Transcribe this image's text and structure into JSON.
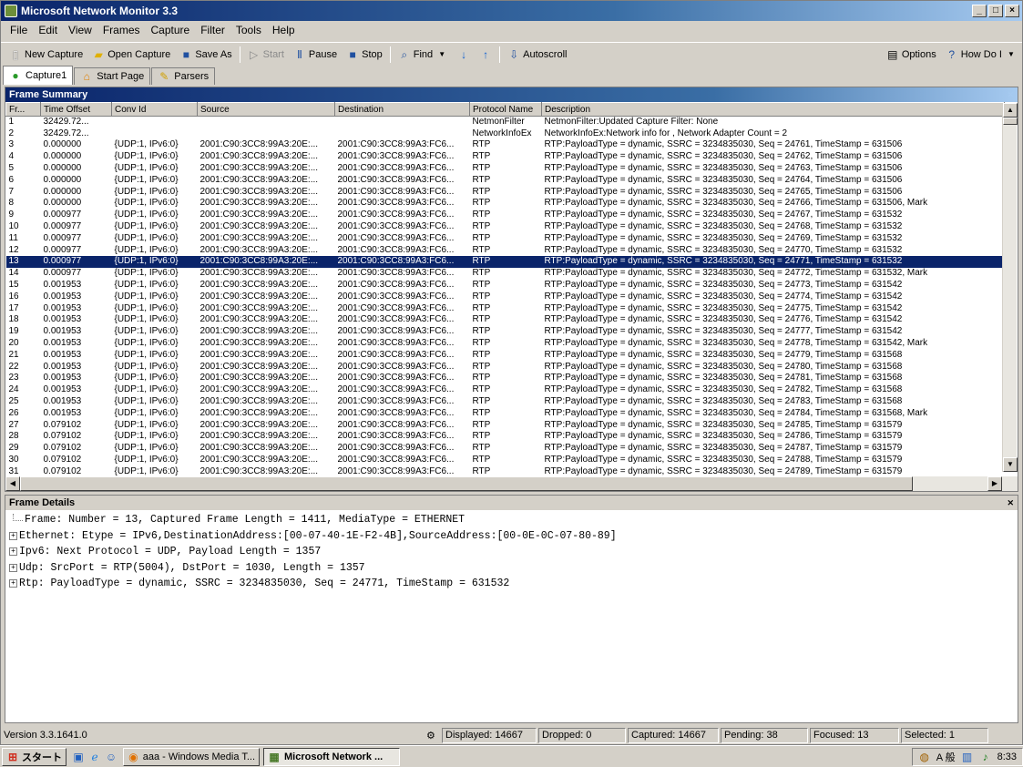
{
  "window": {
    "title": "Microsoft Network Monitor 3.3"
  },
  "menu": [
    "File",
    "Edit",
    "View",
    "Frames",
    "Capture",
    "Filter",
    "Tools",
    "Help"
  ],
  "toolbar": {
    "new_capture": "New Capture",
    "open_capture": "Open Capture",
    "save_as": "Save As",
    "start": "Start",
    "pause": "Pause",
    "stop": "Stop",
    "find": "Find",
    "autoscroll": "Autoscroll",
    "options": "Options",
    "how_do_i": "How Do I"
  },
  "tabs": [
    "Capture1",
    "Start Page",
    "Parsers"
  ],
  "frame_summary": {
    "title": "Frame Summary",
    "columns": [
      "Fr...",
      "Time Offset",
      "Conv Id",
      "Source",
      "Destination",
      "Protocol Name",
      "Description"
    ],
    "selected_row": 12,
    "rows": [
      [
        "1",
        "32429.72...",
        "",
        "",
        "",
        "NetmonFilter",
        "NetmonFilter:Updated Capture Filter: None"
      ],
      [
        "2",
        "32429.72...",
        "",
        "",
        "",
        "NetworkInfoEx",
        "NetworkInfoEx:Network info for , Network Adapter Count = 2"
      ],
      [
        "3",
        "0.000000",
        "{UDP:1, IPv6:0}",
        "2001:C90:3CC8:99A3:20E:...",
        "2001:C90:3CC8:99A3:FC6...",
        "RTP",
        "RTP:PayloadType = dynamic, SSRC = 3234835030, Seq = 24761, TimeStamp = 631506"
      ],
      [
        "4",
        "0.000000",
        "{UDP:1, IPv6:0}",
        "2001:C90:3CC8:99A3:20E:...",
        "2001:C90:3CC8:99A3:FC6...",
        "RTP",
        "RTP:PayloadType = dynamic, SSRC = 3234835030, Seq = 24762, TimeStamp = 631506"
      ],
      [
        "5",
        "0.000000",
        "{UDP:1, IPv6:0}",
        "2001:C90:3CC8:99A3:20E:...",
        "2001:C90:3CC8:99A3:FC6...",
        "RTP",
        "RTP:PayloadType = dynamic, SSRC = 3234835030, Seq = 24763, TimeStamp = 631506"
      ],
      [
        "6",
        "0.000000",
        "{UDP:1, IPv6:0}",
        "2001:C90:3CC8:99A3:20E:...",
        "2001:C90:3CC8:99A3:FC6...",
        "RTP",
        "RTP:PayloadType = dynamic, SSRC = 3234835030, Seq = 24764, TimeStamp = 631506"
      ],
      [
        "7",
        "0.000000",
        "{UDP:1, IPv6:0}",
        "2001:C90:3CC8:99A3:20E:...",
        "2001:C90:3CC8:99A3:FC6...",
        "RTP",
        "RTP:PayloadType = dynamic, SSRC = 3234835030, Seq = 24765, TimeStamp = 631506"
      ],
      [
        "8",
        "0.000000",
        "{UDP:1, IPv6:0}",
        "2001:C90:3CC8:99A3:20E:...",
        "2001:C90:3CC8:99A3:FC6...",
        "RTP",
        "RTP:PayloadType = dynamic, SSRC = 3234835030, Seq = 24766, TimeStamp = 631506, Mark"
      ],
      [
        "9",
        "0.000977",
        "{UDP:1, IPv6:0}",
        "2001:C90:3CC8:99A3:20E:...",
        "2001:C90:3CC8:99A3:FC6...",
        "RTP",
        "RTP:PayloadType = dynamic, SSRC = 3234835030, Seq = 24767, TimeStamp = 631532"
      ],
      [
        "10",
        "0.000977",
        "{UDP:1, IPv6:0}",
        "2001:C90:3CC8:99A3:20E:...",
        "2001:C90:3CC8:99A3:FC6...",
        "RTP",
        "RTP:PayloadType = dynamic, SSRC = 3234835030, Seq = 24768, TimeStamp = 631532"
      ],
      [
        "11",
        "0.000977",
        "{UDP:1, IPv6:0}",
        "2001:C90:3CC8:99A3:20E:...",
        "2001:C90:3CC8:99A3:FC6...",
        "RTP",
        "RTP:PayloadType = dynamic, SSRC = 3234835030, Seq = 24769, TimeStamp = 631532"
      ],
      [
        "12",
        "0.000977",
        "{UDP:1, IPv6:0}",
        "2001:C90:3CC8:99A3:20E:...",
        "2001:C90:3CC8:99A3:FC6...",
        "RTP",
        "RTP:PayloadType = dynamic, SSRC = 3234835030, Seq = 24770, TimeStamp = 631532"
      ],
      [
        "13",
        "0.000977",
        "{UDP:1, IPv6:0}",
        "2001:C90:3CC8:99A3:20E:...",
        "2001:C90:3CC8:99A3:FC6...",
        "RTP",
        "RTP:PayloadType = dynamic, SSRC = 3234835030, Seq = 24771, TimeStamp = 631532"
      ],
      [
        "14",
        "0.000977",
        "{UDP:1, IPv6:0}",
        "2001:C90:3CC8:99A3:20E:...",
        "2001:C90:3CC8:99A3:FC6...",
        "RTP",
        "RTP:PayloadType = dynamic, SSRC = 3234835030, Seq = 24772, TimeStamp = 631532, Mark"
      ],
      [
        "15",
        "0.001953",
        "{UDP:1, IPv6:0}",
        "2001:C90:3CC8:99A3:20E:...",
        "2001:C90:3CC8:99A3:FC6...",
        "RTP",
        "RTP:PayloadType = dynamic, SSRC = 3234835030, Seq = 24773, TimeStamp = 631542"
      ],
      [
        "16",
        "0.001953",
        "{UDP:1, IPv6:0}",
        "2001:C90:3CC8:99A3:20E:...",
        "2001:C90:3CC8:99A3:FC6...",
        "RTP",
        "RTP:PayloadType = dynamic, SSRC = 3234835030, Seq = 24774, TimeStamp = 631542"
      ],
      [
        "17",
        "0.001953",
        "{UDP:1, IPv6:0}",
        "2001:C90:3CC8:99A3:20E:...",
        "2001:C90:3CC8:99A3:FC6...",
        "RTP",
        "RTP:PayloadType = dynamic, SSRC = 3234835030, Seq = 24775, TimeStamp = 631542"
      ],
      [
        "18",
        "0.001953",
        "{UDP:1, IPv6:0}",
        "2001:C90:3CC8:99A3:20E:...",
        "2001:C90:3CC8:99A3:FC6...",
        "RTP",
        "RTP:PayloadType = dynamic, SSRC = 3234835030, Seq = 24776, TimeStamp = 631542"
      ],
      [
        "19",
        "0.001953",
        "{UDP:1, IPv6:0}",
        "2001:C90:3CC8:99A3:20E:...",
        "2001:C90:3CC8:99A3:FC6...",
        "RTP",
        "RTP:PayloadType = dynamic, SSRC = 3234835030, Seq = 24777, TimeStamp = 631542"
      ],
      [
        "20",
        "0.001953",
        "{UDP:1, IPv6:0}",
        "2001:C90:3CC8:99A3:20E:...",
        "2001:C90:3CC8:99A3:FC6...",
        "RTP",
        "RTP:PayloadType = dynamic, SSRC = 3234835030, Seq = 24778, TimeStamp = 631542, Mark"
      ],
      [
        "21",
        "0.001953",
        "{UDP:1, IPv6:0}",
        "2001:C90:3CC8:99A3:20E:...",
        "2001:C90:3CC8:99A3:FC6...",
        "RTP",
        "RTP:PayloadType = dynamic, SSRC = 3234835030, Seq = 24779, TimeStamp = 631568"
      ],
      [
        "22",
        "0.001953",
        "{UDP:1, IPv6:0}",
        "2001:C90:3CC8:99A3:20E:...",
        "2001:C90:3CC8:99A3:FC6...",
        "RTP",
        "RTP:PayloadType = dynamic, SSRC = 3234835030, Seq = 24780, TimeStamp = 631568"
      ],
      [
        "23",
        "0.001953",
        "{UDP:1, IPv6:0}",
        "2001:C90:3CC8:99A3:20E:...",
        "2001:C90:3CC8:99A3:FC6...",
        "RTP",
        "RTP:PayloadType = dynamic, SSRC = 3234835030, Seq = 24781, TimeStamp = 631568"
      ],
      [
        "24",
        "0.001953",
        "{UDP:1, IPv6:0}",
        "2001:C90:3CC8:99A3:20E:...",
        "2001:C90:3CC8:99A3:FC6...",
        "RTP",
        "RTP:PayloadType = dynamic, SSRC = 3234835030, Seq = 24782, TimeStamp = 631568"
      ],
      [
        "25",
        "0.001953",
        "{UDP:1, IPv6:0}",
        "2001:C90:3CC8:99A3:20E:...",
        "2001:C90:3CC8:99A3:FC6...",
        "RTP",
        "RTP:PayloadType = dynamic, SSRC = 3234835030, Seq = 24783, TimeStamp = 631568"
      ],
      [
        "26",
        "0.001953",
        "{UDP:1, IPv6:0}",
        "2001:C90:3CC8:99A3:20E:...",
        "2001:C90:3CC8:99A3:FC6...",
        "RTP",
        "RTP:PayloadType = dynamic, SSRC = 3234835030, Seq = 24784, TimeStamp = 631568, Mark"
      ],
      [
        "27",
        "0.079102",
        "{UDP:1, IPv6:0}",
        "2001:C90:3CC8:99A3:20E:...",
        "2001:C90:3CC8:99A3:FC6...",
        "RTP",
        "RTP:PayloadType = dynamic, SSRC = 3234835030, Seq = 24785, TimeStamp = 631579"
      ],
      [
        "28",
        "0.079102",
        "{UDP:1, IPv6:0}",
        "2001:C90:3CC8:99A3:20E:...",
        "2001:C90:3CC8:99A3:FC6...",
        "RTP",
        "RTP:PayloadType = dynamic, SSRC = 3234835030, Seq = 24786, TimeStamp = 631579"
      ],
      [
        "29",
        "0.079102",
        "{UDP:1, IPv6:0}",
        "2001:C90:3CC8:99A3:20E:...",
        "2001:C90:3CC8:99A3:FC6...",
        "RTP",
        "RTP:PayloadType = dynamic, SSRC = 3234835030, Seq = 24787, TimeStamp = 631579"
      ],
      [
        "30",
        "0.079102",
        "{UDP:1, IPv6:0}",
        "2001:C90:3CC8:99A3:20E:...",
        "2001:C90:3CC8:99A3:FC6...",
        "RTP",
        "RTP:PayloadType = dynamic, SSRC = 3234835030, Seq = 24788, TimeStamp = 631579"
      ],
      [
        "31",
        "0.079102",
        "{UDP:1, IPv6:0}",
        "2001:C90:3CC8:99A3:20E:...",
        "2001:C90:3CC8:99A3:FC6...",
        "RTP",
        "RTP:PayloadType = dynamic, SSRC = 3234835030, Seq = 24789, TimeStamp = 631579"
      ]
    ]
  },
  "frame_details": {
    "title": "Frame Details",
    "lines": [
      {
        "expander": "",
        "text": "Frame: Number = 13, Captured Frame Length = 1411, MediaType = ETHERNET"
      },
      {
        "expander": "+",
        "text": "Ethernet: Etype = IPv6,DestinationAddress:[00-07-40-1E-F2-4B],SourceAddress:[00-0E-0C-07-80-89]"
      },
      {
        "expander": "+",
        "text": "Ipv6: Next Protocol = UDP, Payload Length = 1357"
      },
      {
        "expander": "+",
        "text": "Udp: SrcPort = RTP(5004), DstPort = 1030, Length = 1357"
      },
      {
        "expander": "+",
        "text": "Rtp: PayloadType = dynamic, SSRC = 3234835030, Seq = 24771, TimeStamp = 631532"
      }
    ]
  },
  "statusbar": {
    "version": "Version 3.3.1641.0",
    "displayed": "Displayed: 14667",
    "dropped": "Dropped: 0",
    "captured": "Captured: 14667",
    "pending": "Pending: 38",
    "focused": "Focused: 13",
    "selected": "Selected: 1"
  },
  "taskbar": {
    "start": "スタート",
    "tasks": [
      "aaa - Windows Media T...",
      "Microsoft Network ..."
    ],
    "ime": "A 般",
    "clock": "8:33"
  },
  "colors": {
    "selection": "#0a246a",
    "titlebar": "#0a246a",
    "face": "#d4d0c8"
  }
}
